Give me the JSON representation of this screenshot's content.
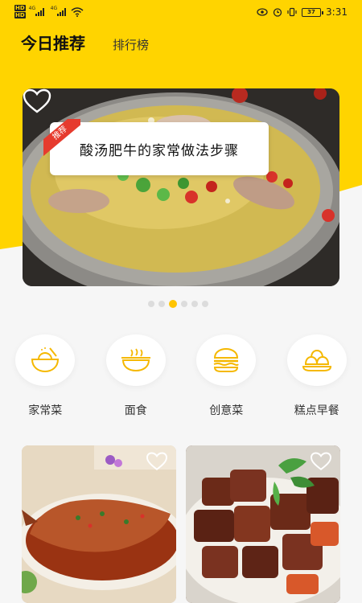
{
  "status_bar": {
    "hd_top": "HD",
    "hd_bottom": "HD",
    "network_1": "4G",
    "network_2": "4G",
    "battery_level": "37",
    "time": "3:31"
  },
  "tabs": [
    {
      "label": "今日推荐",
      "active": true
    },
    {
      "label": "排行榜",
      "active": false
    }
  ],
  "banner": {
    "tag": "推荐",
    "caption": "酸汤肥牛的家常做法步骤",
    "slide_count": 6,
    "active_slide": 3
  },
  "categories": [
    {
      "label": "家常菜",
      "icon": "bowl-icon"
    },
    {
      "label": "面食",
      "icon": "noodle-bowl-icon"
    },
    {
      "label": "创意菜",
      "icon": "burger-icon"
    },
    {
      "label": "糕点早餐",
      "icon": "buns-icon"
    }
  ],
  "colors": {
    "accent": "#ffd400",
    "tag_red": "#e63b2e",
    "icon_yellow": "#f5b800"
  }
}
